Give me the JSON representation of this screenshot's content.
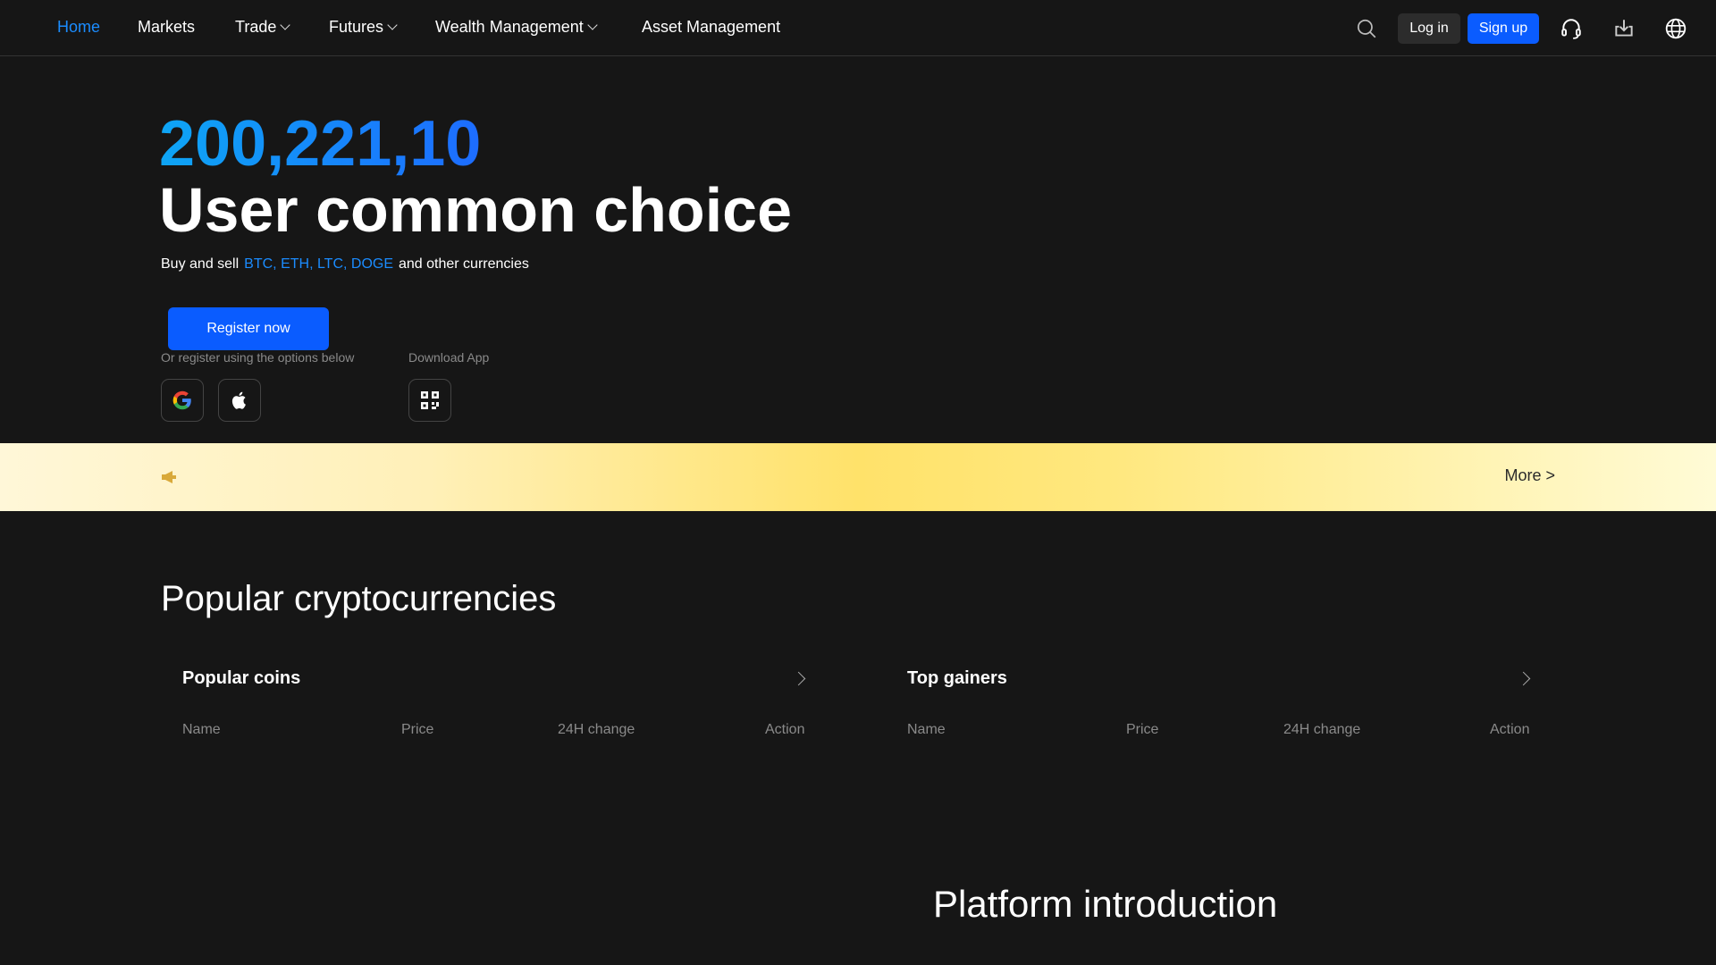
{
  "nav": {
    "items": [
      "Home",
      "Markets",
      "Trade",
      "Futures",
      "Wealth Management",
      "Asset Management"
    ],
    "login": "Log in",
    "signup": "Sign up"
  },
  "hero": {
    "number": "200,221,10",
    "title": "User common choice",
    "sub_prefix": "Buy and sell",
    "sub_coins": "BTC, ETH, LTC, DOGE",
    "sub_suffix": "and other currencies",
    "register": "Register now",
    "register_options": "Or register using the options below",
    "download_app": "Download App"
  },
  "banner": {
    "more": "More >"
  },
  "popular": {
    "title": "Popular cryptocurrencies",
    "cards": [
      {
        "title": "Popular coins",
        "columns": [
          "Name",
          "Price",
          "24H change",
          "Action"
        ]
      },
      {
        "title": "Top gainers",
        "columns": [
          "Name",
          "Price",
          "24H change",
          "Action"
        ]
      }
    ]
  },
  "platform": {
    "title": "Platform introduction"
  },
  "colors": {
    "accent": "#0a5cff",
    "link": "#1b8cff",
    "bg": "#161616"
  }
}
